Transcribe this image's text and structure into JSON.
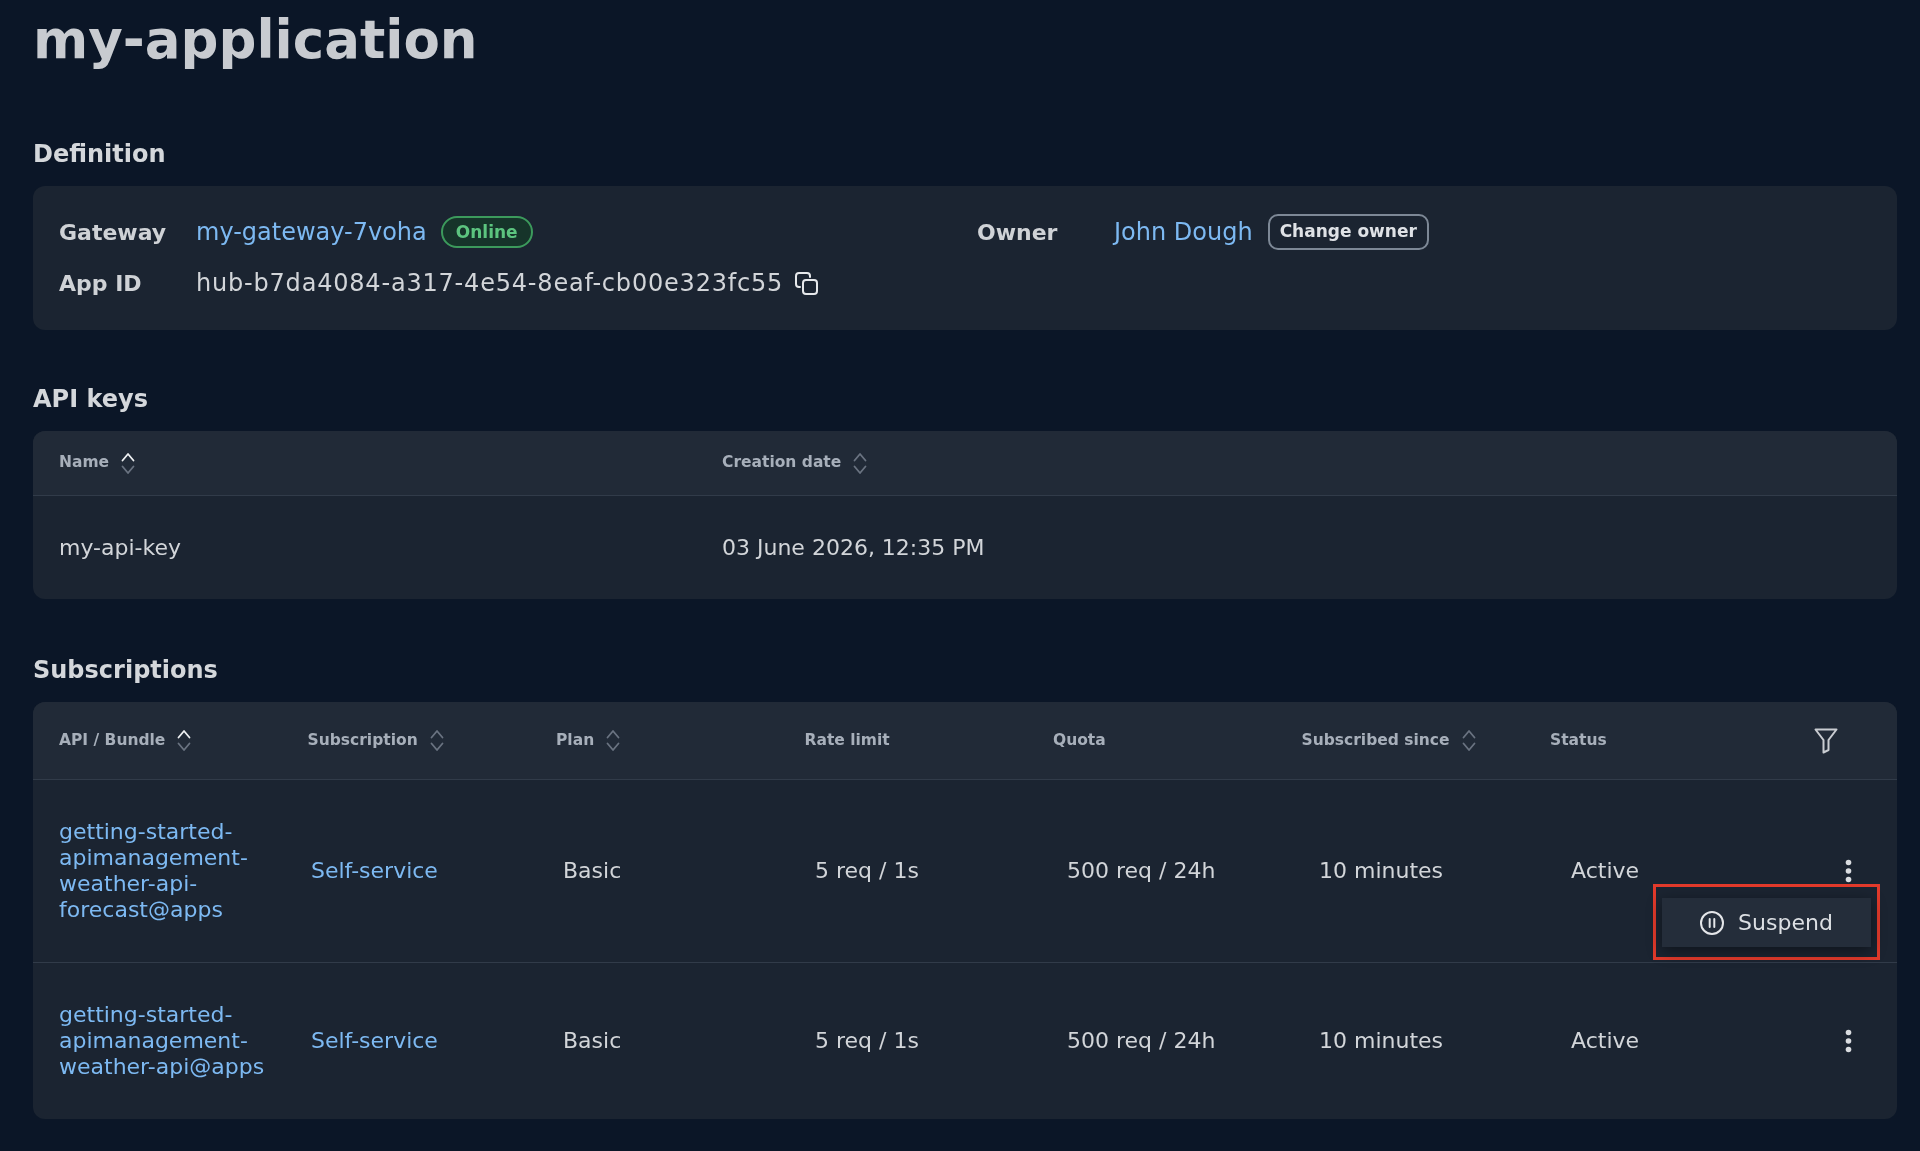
{
  "page_title": "my-application",
  "definition": {
    "heading": "Definition",
    "gateway": {
      "label": "Gateway",
      "value": "my-gateway-7voha",
      "status": "Online"
    },
    "app_id": {
      "label": "App ID",
      "value": "hub-b7da4084-a317-4e54-8eaf-cb00e323fc55"
    },
    "owner": {
      "label": "Owner",
      "value": "John Dough",
      "button": "Change owner"
    }
  },
  "api_keys": {
    "heading": "API keys",
    "columns": [
      {
        "label": "Name",
        "sortable": true,
        "sorted": true
      },
      {
        "label": "Creation date",
        "sortable": true,
        "sorted": false
      }
    ],
    "rows": [
      {
        "cells": [
          {
            "kind": "text",
            "text": "my-api-key"
          },
          {
            "kind": "text",
            "text": "03 June 2026, 12:35 PM"
          }
        ]
      }
    ]
  },
  "subscriptions": {
    "heading": "Subscriptions",
    "columns": [
      {
        "label": "API / Bundle",
        "sortable": true,
        "sorted": true
      },
      {
        "label": "Subscription",
        "sortable": true,
        "sorted": false
      },
      {
        "label": "Plan",
        "sortable": true,
        "sorted": false
      },
      {
        "label": "Rate limit",
        "sortable": false
      },
      {
        "label": "Quota",
        "sortable": false
      },
      {
        "label": "Subscribed since",
        "sortable": true,
        "sorted": false
      },
      {
        "label": "Status",
        "sortable": false
      }
    ],
    "rows": [
      {
        "cells": [
          {
            "kind": "link",
            "text": "getting-started-apimanagement-weather-api-forecast@apps"
          },
          {
            "kind": "link",
            "text": "Self-service"
          },
          {
            "kind": "text",
            "text": "Basic"
          },
          {
            "kind": "text",
            "text": "5 req / 1s"
          },
          {
            "kind": "text",
            "text": "500 req / 24h"
          },
          {
            "kind": "text",
            "text": "10 minutes"
          },
          {
            "kind": "text",
            "text": "Active"
          }
        ],
        "actions_menu": {
          "open": true,
          "highlighted": true,
          "items": [
            {
              "label": "Suspend"
            }
          ]
        }
      },
      {
        "cells": [
          {
            "kind": "link",
            "text": "getting-started-apimanagement-weather-api@apps"
          },
          {
            "kind": "link",
            "text": "Self-service"
          },
          {
            "kind": "text",
            "text": "Basic"
          },
          {
            "kind": "text",
            "text": "5 req / 1s"
          },
          {
            "kind": "text",
            "text": "500 req / 24h"
          },
          {
            "kind": "text",
            "text": "10 minutes"
          },
          {
            "kind": "text",
            "text": "Active"
          }
        ],
        "actions_menu": {
          "open": false
        }
      }
    ]
  }
}
